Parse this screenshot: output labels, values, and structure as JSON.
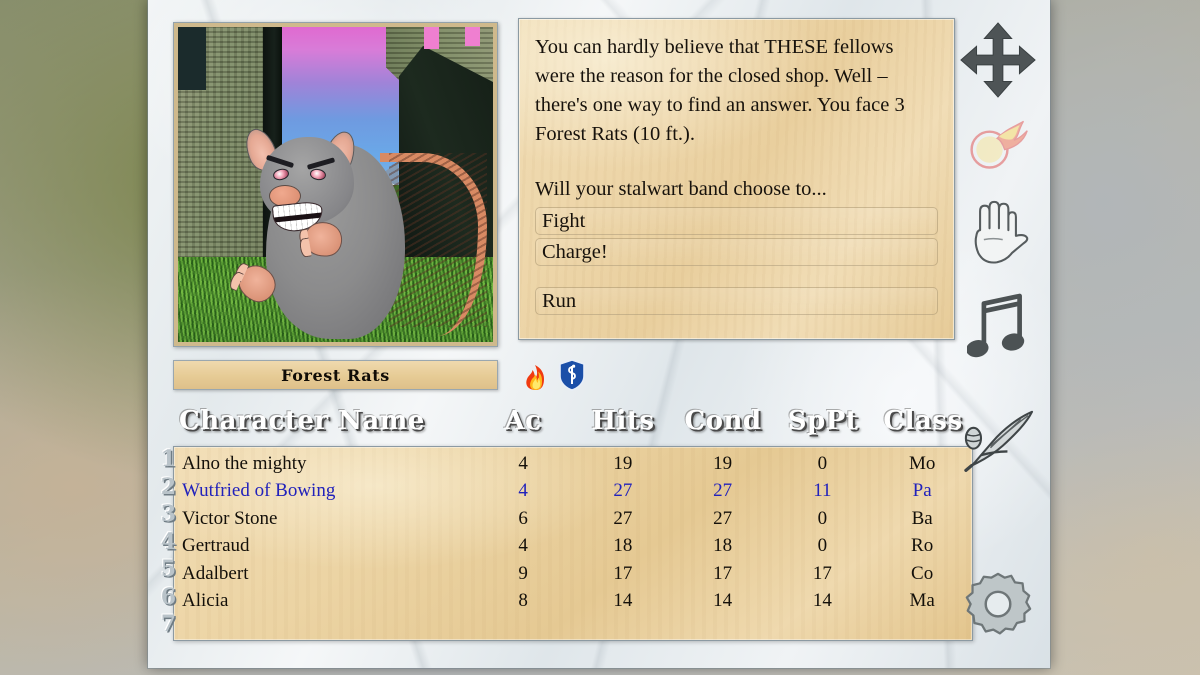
{
  "window": {
    "title": "combat-encounter"
  },
  "portrait": {
    "alt": "forest-rat-illustration"
  },
  "narration": {
    "text": "You can hardly believe that THESE fellows were the reason for the closed shop. Well – there's one way to find an answer. You face 3 Forest Rats (10 ft.).",
    "prompt": "Will your stalwart band choose to..."
  },
  "choices": [
    {
      "label": "Fight"
    },
    {
      "label": "Charge!"
    },
    {
      "label": "Run"
    }
  ],
  "enemy": {
    "name": "Forest Rats",
    "status_icons": [
      {
        "name": "flame-icon"
      },
      {
        "name": "shield-serpent-icon"
      }
    ]
  },
  "roster": {
    "headers": [
      "Character Name",
      "Ac",
      "Hits",
      "Cond",
      "SpPt",
      "Class"
    ],
    "row_numbers": [
      "1",
      "2",
      "3",
      "4",
      "5",
      "6",
      "7"
    ],
    "rows": [
      {
        "name": "Alno the mighty",
        "ac": "4",
        "hits": "19",
        "cond": "19",
        "sppt": "0",
        "cls": "Mo",
        "selected": false
      },
      {
        "name": "Wutfried of Bowing",
        "ac": "4",
        "hits": "27",
        "cond": "27",
        "sppt": "11",
        "cls": "Pa",
        "selected": true
      },
      {
        "name": "Victor Stone",
        "ac": "6",
        "hits": "27",
        "cond": "27",
        "sppt": "0",
        "cls": "Ba",
        "selected": false
      },
      {
        "name": "Gertraud",
        "ac": "4",
        "hits": "18",
        "cond": "18",
        "sppt": "0",
        "cls": "Ro",
        "selected": false
      },
      {
        "name": "Adalbert",
        "ac": "9",
        "hits": "17",
        "cond": "17",
        "sppt": "17",
        "cls": "Co",
        "selected": false
      },
      {
        "name": "Alicia",
        "ac": "8",
        "hits": "14",
        "cond": "14",
        "sppt": "14",
        "cls": "Ma",
        "selected": false
      }
    ]
  },
  "toolbar": [
    {
      "name": "move-arrows-icon"
    },
    {
      "name": "fireball-spell-icon"
    },
    {
      "name": "hand-palm-icon"
    },
    {
      "name": "music-note-icon"
    },
    {
      "name": "quill-pen-icon"
    },
    {
      "name": "gear-settings-icon"
    }
  ],
  "colors": {
    "selected_row": "#2222bb",
    "parchment": "#e9cf9e",
    "marble": "#eaf0f2",
    "shield_blue": "#1b4fa8"
  }
}
